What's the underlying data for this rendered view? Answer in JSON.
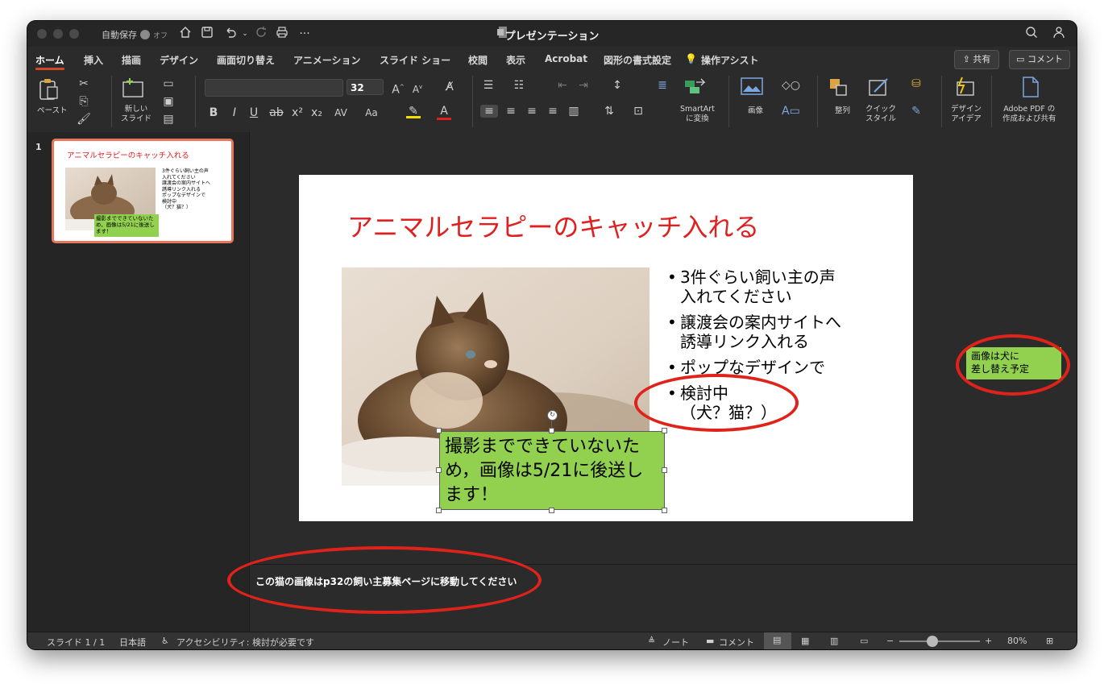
{
  "titlebar": {
    "autosave_label": "自動保存",
    "autosave_state": "オフ",
    "document_title": "プレゼンテーション",
    "icons": [
      "home-icon",
      "save-icon",
      "undo-icon",
      "redo-icon",
      "print-icon",
      "more-icon",
      "search-icon",
      "account-icon"
    ]
  },
  "tabs": [
    "ホーム",
    "挿入",
    "描画",
    "デザイン",
    "画面切り替え",
    "アニメーション",
    "スライド ショー",
    "校閲",
    "表示",
    "Acrobat",
    "図形の書式設定",
    "操作アシスト"
  ],
  "header_buttons": {
    "share": "共有",
    "comments": "コメント"
  },
  "ribbon": {
    "paste": "ペースト",
    "new_slide": "新しい\nスライド",
    "font_size": "32",
    "smartart": "SmartArt\nに変換",
    "image": "画像",
    "arrange": "整列",
    "quick_style": "クイック\nスタイル",
    "design_ideas": "デザイン\nアイデア",
    "adobe_pdf": "Adobe PDF の\n作成および共有"
  },
  "thumbnails": [
    {
      "number": "1",
      "title": "アニマルセラピーのキャッチ入れる",
      "bullets": [
        "3件ぐらい飼い主の声\n入れてください",
        "譲渡会の案内サイトへ\n誘導リンク入れる",
        "ポップなデザインで",
        "検討中\n（犬？猫？）"
      ],
      "note": "撮影までできていないため，画像は5/21に後送します！"
    }
  ],
  "slide": {
    "title": "アニマルセラピーのキャッチ入れる",
    "bullets": [
      "3件ぐらい飼い主の声\n入れてください",
      "譲渡会の案内サイトへ\n誘導リンク入れる",
      "ポップなデザインで",
      "検討中\n（犬？猫？）"
    ],
    "green_box_text": "撮影までできていないため，画像は5/21に後送します！",
    "image_alt": "cat-photo"
  },
  "side_note": "画像は犬に\n差し替え予定",
  "notes_text": "この猫の画像はp32の飼い主募集ページに移動してください",
  "status": {
    "slide_counter": "スライド 1 / 1",
    "language": "日本語",
    "accessibility": "アクセシビリティ: 検討が必要です",
    "notes_button": "ノート",
    "comments_button": "コメント",
    "zoom": "80%"
  },
  "colors": {
    "accent": "#d24726",
    "annotation_red": "#e0231a",
    "note_green": "#92d050",
    "title_red": "#e02020"
  }
}
